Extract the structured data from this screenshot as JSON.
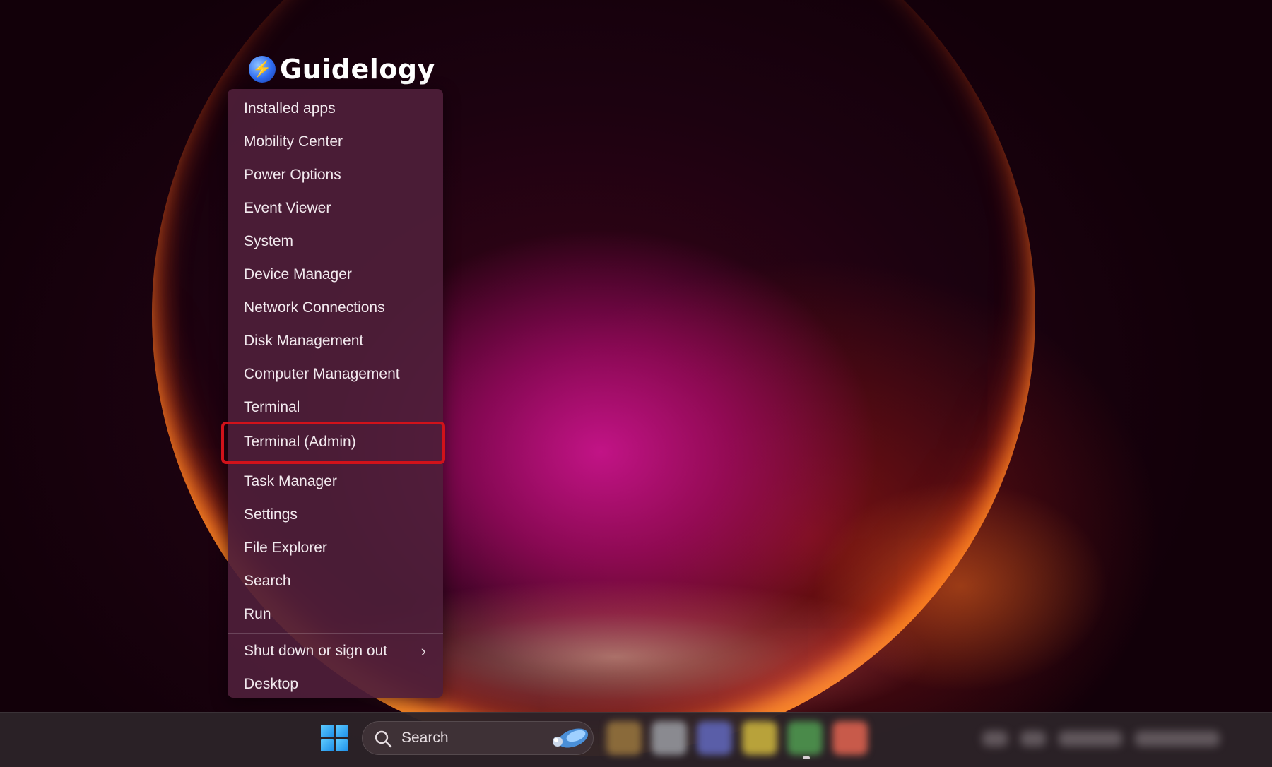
{
  "logo": {
    "text": "Guidelogy",
    "icon": "lightning-bolt-icon"
  },
  "menu": {
    "items": [
      {
        "label": "Installed apps"
      },
      {
        "label": "Mobility Center"
      },
      {
        "label": "Power Options"
      },
      {
        "label": "Event Viewer"
      },
      {
        "label": "System"
      },
      {
        "label": "Device Manager"
      },
      {
        "label": "Network Connections"
      },
      {
        "label": "Disk Management"
      },
      {
        "label": "Computer Management"
      },
      {
        "label": "Terminal"
      },
      {
        "label": "Terminal (Admin)",
        "highlighted": true
      },
      {
        "label": "Task Manager"
      },
      {
        "label": "Settings"
      },
      {
        "label": "File Explorer"
      },
      {
        "label": "Search"
      },
      {
        "label": "Run"
      },
      {
        "label": "Shut down or sign out",
        "has_submenu": true
      },
      {
        "label": "Desktop"
      }
    ],
    "submenu_chevron": "›",
    "highlight_color": "#d1121a"
  },
  "taskbar": {
    "start_icon": "windows-logo-icon",
    "search": {
      "label": "Search",
      "icon": "search-icon",
      "decoration_icon": "bing-icon"
    },
    "accent": "#1e8fe8"
  }
}
